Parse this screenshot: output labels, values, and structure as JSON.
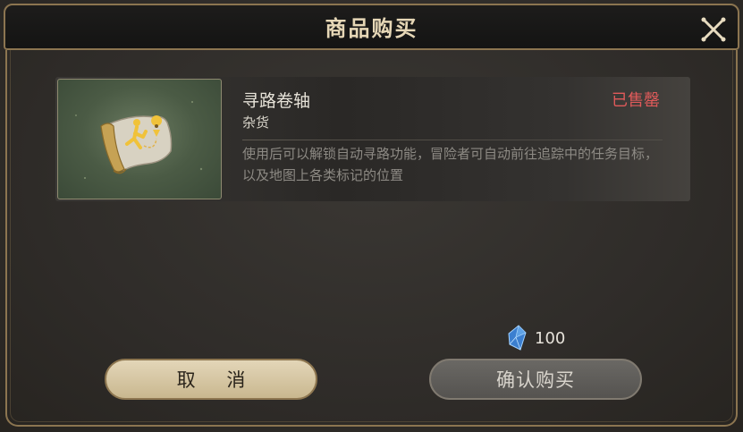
{
  "dialog": {
    "title": "商品购买"
  },
  "item": {
    "name": "寻路卷轴",
    "category": "杂货",
    "status": "已售罄",
    "description": "使用后可以解锁自动寻路功能，冒险者可自动前往追踪中的任务目标，以及地图上各类标记的位置",
    "icon": "map-scroll-icon"
  },
  "price": {
    "currency_icon": "blue-crystal-icon",
    "value": "100"
  },
  "buttons": {
    "cancel": "取 消",
    "confirm": "确认购买"
  },
  "colors": {
    "frame_gold": "#8c7550",
    "sold_out_red": "#e05a5a",
    "cancel_button": "#d8c9a6",
    "confirm_button_disabled": "#5f5d59"
  }
}
